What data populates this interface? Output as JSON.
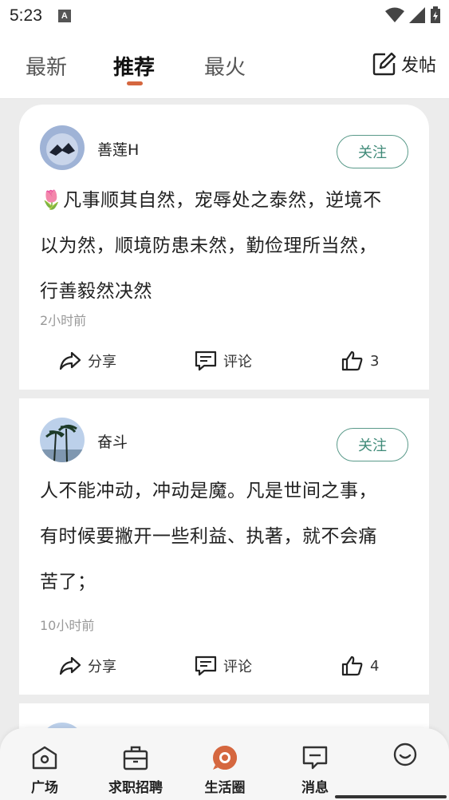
{
  "status_bar": {
    "time": "5:23",
    "badge": "A"
  },
  "top_tabs": [
    {
      "label": "最新",
      "active": false
    },
    {
      "label": "推荐",
      "active": true
    },
    {
      "label": "最火",
      "active": false
    }
  ],
  "post_button": {
    "label": "发帖",
    "icon": "edit-icon"
  },
  "accent_color": "#d5673f",
  "follow_color": "#3f8a78",
  "posts": [
    {
      "username": "善莲H",
      "follow_label": "关注",
      "content_lines": [
        "🌷凡事顺其自然，宠辱处之泰然，逆境不",
        "以为然，顺境防患未然，勤俭理所当然，",
        "行善毅然决然"
      ],
      "time": "2小时前",
      "share_label": "分享",
      "comment_label": "评论",
      "likes": "3"
    },
    {
      "username": "奋斗",
      "follow_label": "关注",
      "content_lines": [
        "人不能冲动，冲动是魔。凡是世间之事，",
        "有时候要撇开一些利益、执著，就不会痛",
        "苦了；"
      ],
      "time": "10小时前",
      "share_label": "分享",
      "comment_label": "评论",
      "likes": "4"
    }
  ],
  "bottom_nav": [
    {
      "label": "广场",
      "icon": "square-home-icon"
    },
    {
      "label": "求职招聘",
      "icon": "briefcase-icon"
    },
    {
      "label": "生活圈",
      "icon": "life-circle-icon",
      "color": "#d5673f"
    },
    {
      "label": "消息",
      "icon": "message-icon"
    },
    {
      "label": "",
      "icon": "smiley-icon"
    }
  ]
}
